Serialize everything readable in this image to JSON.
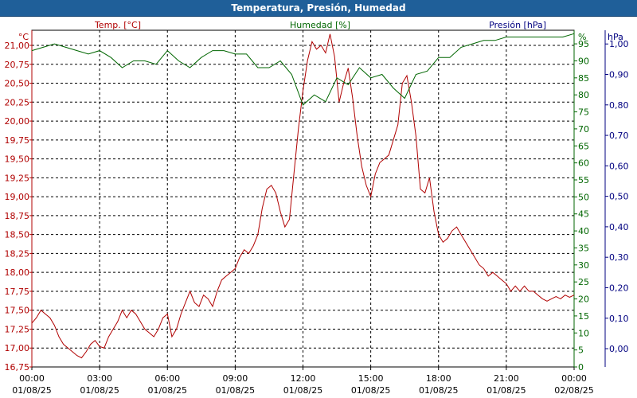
{
  "window": {
    "title": "Temperatura, Presión, Humedad"
  },
  "chart_data": {
    "type": "line",
    "title": "Temperatura, Presión, Humedad",
    "x_ticks": [
      {
        "time": "00:00",
        "date": "01/08/25"
      },
      {
        "time": "03:00",
        "date": "01/08/25"
      },
      {
        "time": "06:00",
        "date": "01/08/25"
      },
      {
        "time": "09:00",
        "date": "01/08/25"
      },
      {
        "time": "12:00",
        "date": "01/08/25"
      },
      {
        "time": "15:00",
        "date": "01/08/25"
      },
      {
        "time": "18:00",
        "date": "01/08/25"
      },
      {
        "time": "21:00",
        "date": "01/08/25"
      },
      {
        "time": "00:00",
        "date": "02/08/25"
      }
    ],
    "x_range_hours": [
      0,
      24
    ],
    "grid": true,
    "axes": {
      "temperature": {
        "unit": "°C",
        "side": "left",
        "range": [
          16.75,
          21.2
        ],
        "ticks": [
          "16,75",
          "17,00",
          "17,25",
          "17,50",
          "17,75",
          "18,00",
          "18,25",
          "18,50",
          "18,75",
          "19,00",
          "19,25",
          "19,50",
          "19,75",
          "20,00",
          "20,25",
          "20,50",
          "20,75",
          "21,00"
        ],
        "tick_values": [
          16.75,
          17.0,
          17.25,
          17.5,
          17.75,
          18.0,
          18.25,
          18.5,
          18.75,
          19.0,
          19.25,
          19.5,
          19.75,
          20.0,
          20.25,
          20.5,
          20.75,
          21.0
        ]
      },
      "humidity": {
        "unit": "%",
        "side": "right",
        "range": [
          0,
          99
        ],
        "ticks": [
          "0",
          "5",
          "10",
          "15",
          "20",
          "25",
          "30",
          "35",
          "40",
          "45",
          "50",
          "55",
          "60",
          "65",
          "70",
          "75",
          "80",
          "85",
          "90",
          "95"
        ],
        "tick_values": [
          0,
          5,
          10,
          15,
          20,
          25,
          30,
          35,
          40,
          45,
          50,
          55,
          60,
          65,
          70,
          75,
          80,
          85,
          90,
          95
        ]
      },
      "pressure": {
        "unit": "hPa",
        "side": "right-outer",
        "range": [
          -0.06,
          1.045
        ],
        "ticks": [
          "0,00",
          "0,10",
          "0,20",
          "0,30",
          "0,40",
          "0,50",
          "0,60",
          "0,70",
          "0,80",
          "0,90",
          "1,00"
        ],
        "tick_values": [
          0.0,
          0.1,
          0.2,
          0.3,
          0.4,
          0.5,
          0.6,
          0.7,
          0.8,
          0.9,
          1.0
        ]
      }
    },
    "series": [
      {
        "name": "Temp. [°C]",
        "axis": "temperature",
        "color": "#b00000",
        "x": [
          0,
          0.2,
          0.4,
          0.6,
          0.8,
          1.0,
          1.2,
          1.4,
          1.6,
          1.8,
          2.0,
          2.2,
          2.4,
          2.6,
          2.8,
          3.0,
          3.2,
          3.4,
          3.6,
          3.8,
          4.0,
          4.2,
          4.4,
          4.6,
          4.8,
          5.0,
          5.2,
          5.4,
          5.6,
          5.8,
          6.0,
          6.2,
          6.4,
          6.6,
          6.8,
          7.0,
          7.2,
          7.4,
          7.6,
          7.8,
          8.0,
          8.2,
          8.4,
          8.6,
          8.8,
          9.0,
          9.2,
          9.4,
          9.6,
          9.8,
          10.0,
          10.2,
          10.4,
          10.6,
          10.8,
          11.0,
          11.2,
          11.4,
          11.6,
          11.8,
          12.0,
          12.2,
          12.4,
          12.6,
          12.8,
          13.0,
          13.2,
          13.4,
          13.6,
          13.8,
          14.0,
          14.2,
          14.4,
          14.6,
          14.8,
          15.0,
          15.2,
          15.4,
          15.6,
          15.8,
          16.0,
          16.2,
          16.4,
          16.6,
          16.8,
          17.0,
          17.2,
          17.4,
          17.6,
          17.8,
          18.0,
          18.2,
          18.4,
          18.6,
          18.8,
          19.0,
          19.2,
          19.4,
          19.6,
          19.8,
          20.0,
          20.2,
          20.4,
          20.6,
          20.8,
          21.0,
          21.2,
          21.4,
          21.6,
          21.8,
          22.0,
          22.2,
          22.4,
          22.6,
          22.8,
          23.0,
          23.2,
          23.4,
          23.6,
          23.8,
          24.0
        ],
        "values": [
          17.33,
          17.4,
          17.5,
          17.45,
          17.4,
          17.3,
          17.15,
          17.05,
          17.0,
          16.95,
          16.9,
          16.87,
          16.95,
          17.05,
          17.1,
          17.02,
          17.0,
          17.15,
          17.25,
          17.35,
          17.5,
          17.4,
          17.5,
          17.45,
          17.35,
          17.25,
          17.2,
          17.15,
          17.25,
          17.4,
          17.45,
          17.15,
          17.25,
          17.45,
          17.6,
          17.75,
          17.6,
          17.55,
          17.7,
          17.65,
          17.55,
          17.75,
          17.9,
          17.95,
          18.0,
          18.05,
          18.2,
          18.3,
          18.25,
          18.35,
          18.5,
          18.85,
          19.1,
          19.15,
          19.05,
          18.8,
          18.6,
          18.7,
          19.3,
          19.9,
          20.4,
          20.8,
          21.05,
          20.95,
          21.0,
          20.9,
          21.15,
          20.85,
          20.25,
          20.5,
          20.7,
          20.3,
          19.8,
          19.4,
          19.15,
          19.0,
          19.3,
          19.45,
          19.5,
          19.55,
          19.75,
          19.95,
          20.5,
          20.6,
          20.25,
          19.8,
          19.1,
          19.05,
          19.25,
          18.8,
          18.5,
          18.4,
          18.45,
          18.55,
          18.6,
          18.5,
          18.4,
          18.3,
          18.2,
          18.1,
          18.05,
          17.95,
          18.0,
          17.95,
          17.9,
          17.85,
          17.75,
          17.82,
          17.75,
          17.82,
          17.75,
          17.75,
          17.7,
          17.65,
          17.62,
          17.65,
          17.68,
          17.65,
          17.7,
          17.67,
          17.7
        ]
      },
      {
        "name": "Humedad [%]",
        "axis": "humidity",
        "color": "#006600",
        "x": [
          0,
          0.5,
          1.0,
          1.5,
          2.0,
          2.5,
          3.0,
          3.5,
          4.0,
          4.5,
          5.0,
          5.5,
          6.0,
          6.5,
          7.0,
          7.5,
          8.0,
          8.5,
          9.0,
          9.5,
          10.0,
          10.5,
          11.0,
          11.5,
          12.0,
          12.5,
          13.0,
          13.5,
          14.0,
          14.5,
          15.0,
          15.5,
          16.0,
          16.5,
          17.0,
          17.5,
          18.0,
          18.5,
          19.0,
          19.5,
          20.0,
          20.5,
          21.0,
          21.5,
          22.0,
          22.5,
          23.0,
          23.5,
          24.0
        ],
        "values": [
          93,
          94,
          95,
          94,
          93,
          92,
          93,
          91,
          88,
          90,
          90,
          89,
          93,
          90,
          88,
          91,
          93,
          93,
          92,
          92,
          88,
          88,
          90,
          86,
          77,
          80,
          78,
          85,
          83,
          88,
          85,
          86,
          82,
          79,
          86,
          87,
          91,
          91,
          94,
          95,
          96,
          96,
          97,
          97,
          97,
          97,
          97,
          97,
          98
        ]
      },
      {
        "name": "Presión [hPa]",
        "axis": "pressure",
        "color": "#000080",
        "x": [],
        "values": []
      }
    ]
  }
}
